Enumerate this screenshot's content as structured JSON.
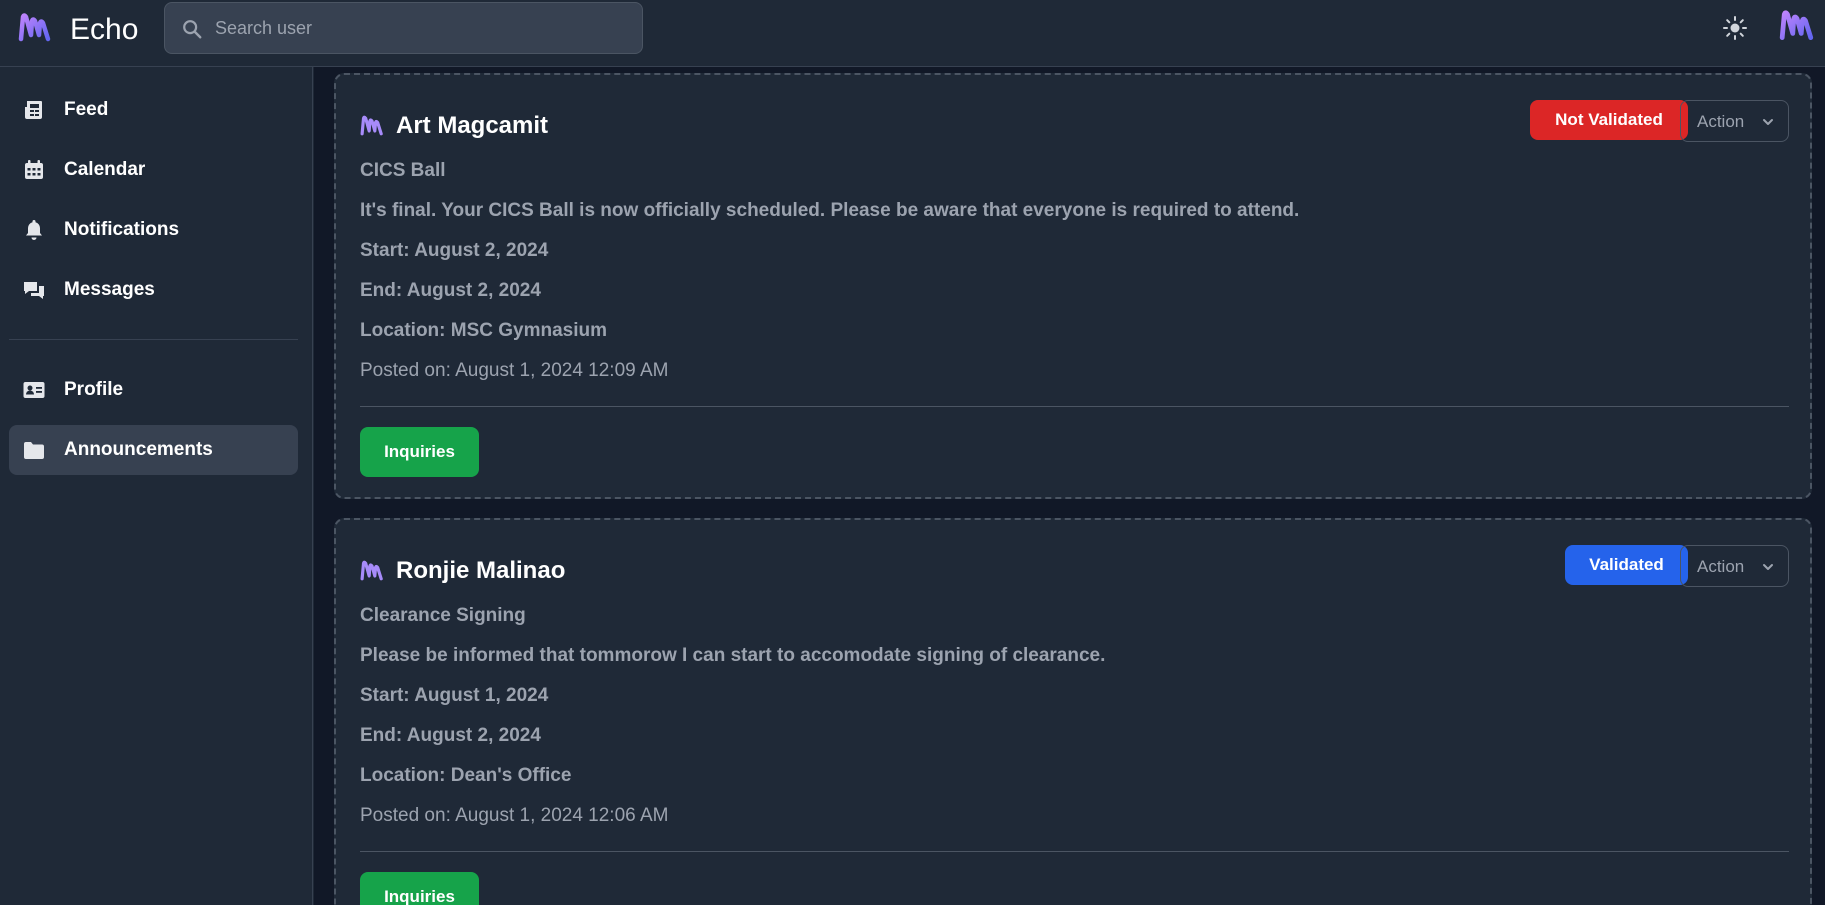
{
  "app": {
    "name": "Echo",
    "accent": "#a855f7"
  },
  "search": {
    "placeholder": "Search user",
    "value": ""
  },
  "sidebar": {
    "items": [
      {
        "label": "Feed",
        "icon": "newspaper-icon"
      },
      {
        "label": "Calendar",
        "icon": "calendar-icon"
      },
      {
        "label": "Notifications",
        "icon": "bell-icon"
      },
      {
        "label": "Messages",
        "icon": "chat-bubbles-icon"
      },
      {
        "label": "Profile",
        "icon": "id-card-icon"
      },
      {
        "label": "Announcements",
        "icon": "folder-icon",
        "active": true
      }
    ]
  },
  "announcements": [
    {
      "author": "Art Magcamit",
      "status": "Not Validated",
      "status_color": "#dc2626",
      "action_label": "Action",
      "title": "CICS Ball",
      "body": "It's final. Your CICS Ball is now officially scheduled. Please be aware that everyone is required to attend.",
      "start": "Start: August 2, 2024",
      "end": "End: August 2, 2024",
      "location": "Location: MSC Gymnasium",
      "posted": "Posted on: August 1, 2024 12:09 AM",
      "inquiries_label": "Inquiries"
    },
    {
      "author": "Ronjie Malinao",
      "status": "Validated",
      "status_color": "#2563eb",
      "action_label": "Action",
      "title": "Clearance Signing",
      "body": "Please be informed that tommorow I can start to accomodate signing of clearance.",
      "start": "Start: August 1, 2024",
      "end": "End: August 2, 2024",
      "location": "Location: Dean's Office",
      "posted": "Posted on: August 1, 2024 12:06 AM",
      "inquiries_label": "Inquiries"
    }
  ]
}
